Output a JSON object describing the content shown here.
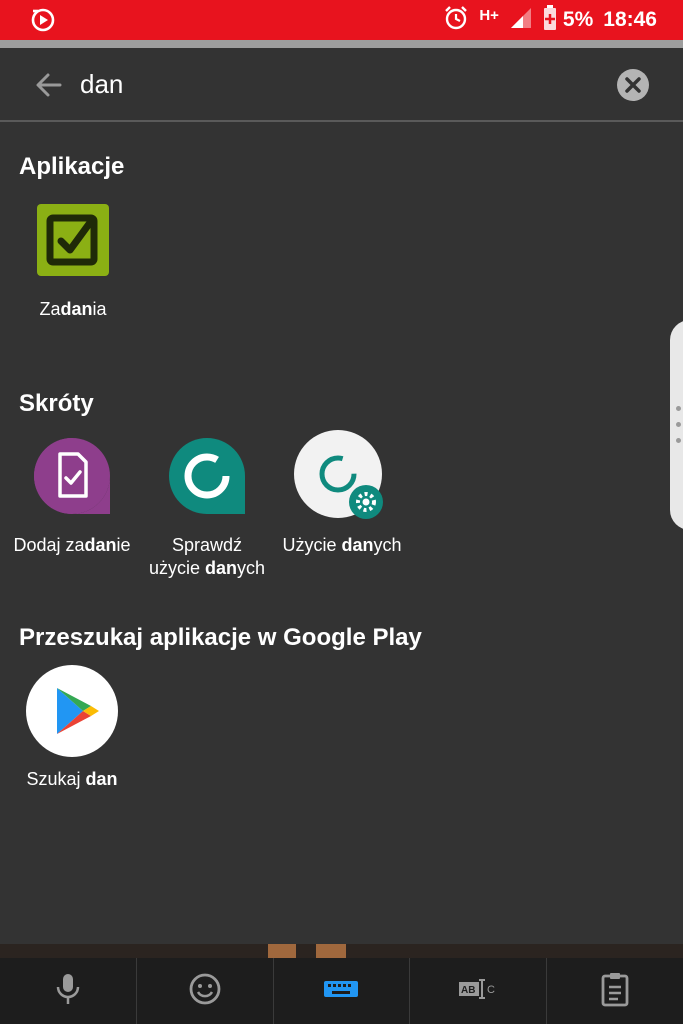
{
  "status": {
    "time": "18:46",
    "battery": "5%",
    "network": "H+"
  },
  "search": {
    "query": "dan",
    "placeholder": ""
  },
  "sections": {
    "apps_title": "Aplikacje",
    "shortcuts_title": "Skróty",
    "play_title": "Przeszukaj aplikacje w Google Play"
  },
  "apps": [
    {
      "pre": "Za",
      "bold": "dan",
      "post": "ia"
    }
  ],
  "shortcuts": [
    {
      "line1_pre": "Dodaj za",
      "line1_bold": "dan",
      "line1_post": "ie",
      "line2_pre": "",
      "line2_bold": "",
      "line2_post": ""
    },
    {
      "line1_pre": "Sprawdź",
      "line1_bold": "",
      "line1_post": "",
      "line2_pre": "użycie ",
      "line2_bold": "dan",
      "line2_post": "ych"
    },
    {
      "line1_pre": "Użycie ",
      "line1_bold": "dan",
      "line1_post": "ych",
      "line2_pre": "",
      "line2_bold": "",
      "line2_post": ""
    }
  ],
  "play": {
    "pre": "Szukaj ",
    "bold": "dan"
  },
  "colors": {
    "status_bar": "#e8131e",
    "background": "#333333",
    "tasks_icon": "#8bb014",
    "teal": "#0f8a7e",
    "purple": "#8e3e8c",
    "keyboard_active": "#2196f3"
  },
  "keyboard": {
    "buttons": [
      "mic-icon",
      "emoji-icon",
      "keyboard-icon",
      "text-select-icon",
      "clipboard-icon"
    ]
  }
}
